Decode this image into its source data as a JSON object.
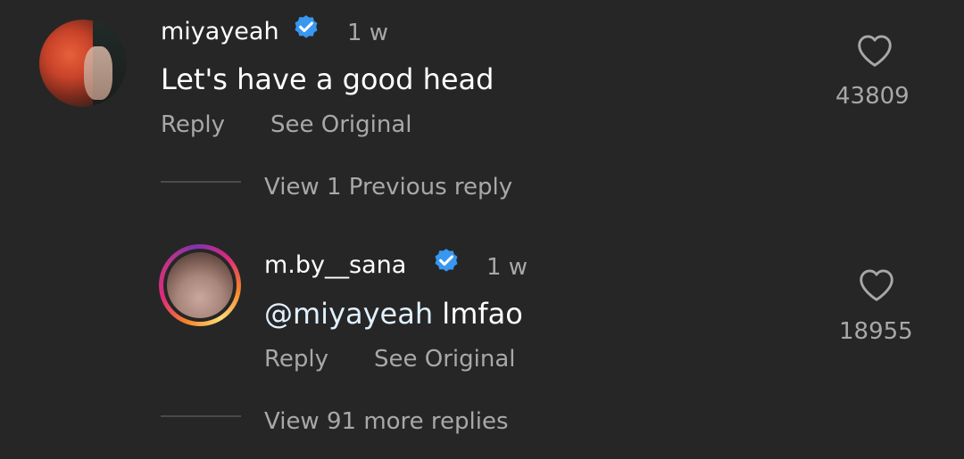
{
  "comments": [
    {
      "username": "miyayeah",
      "time": "1 w",
      "text": "Let's have a good head",
      "reply_label": "Reply",
      "see_original_label": "See Original",
      "likes": "43809",
      "view_replies_label": "View 1 Previous reply"
    },
    {
      "username": "m.by__sana",
      "time": "1 w",
      "mention": "@miyayeah",
      "text": " lmfao",
      "reply_label": "Reply",
      "see_original_label": "See Original",
      "likes": "18955",
      "view_replies_label": "View 91 more replies"
    }
  ],
  "colors": {
    "background": "#262626",
    "verified": "#3897f0",
    "secondary_text": "#a8a8a8"
  },
  "icons": {
    "verified": "verified-badge-icon",
    "like": "heart-icon"
  }
}
